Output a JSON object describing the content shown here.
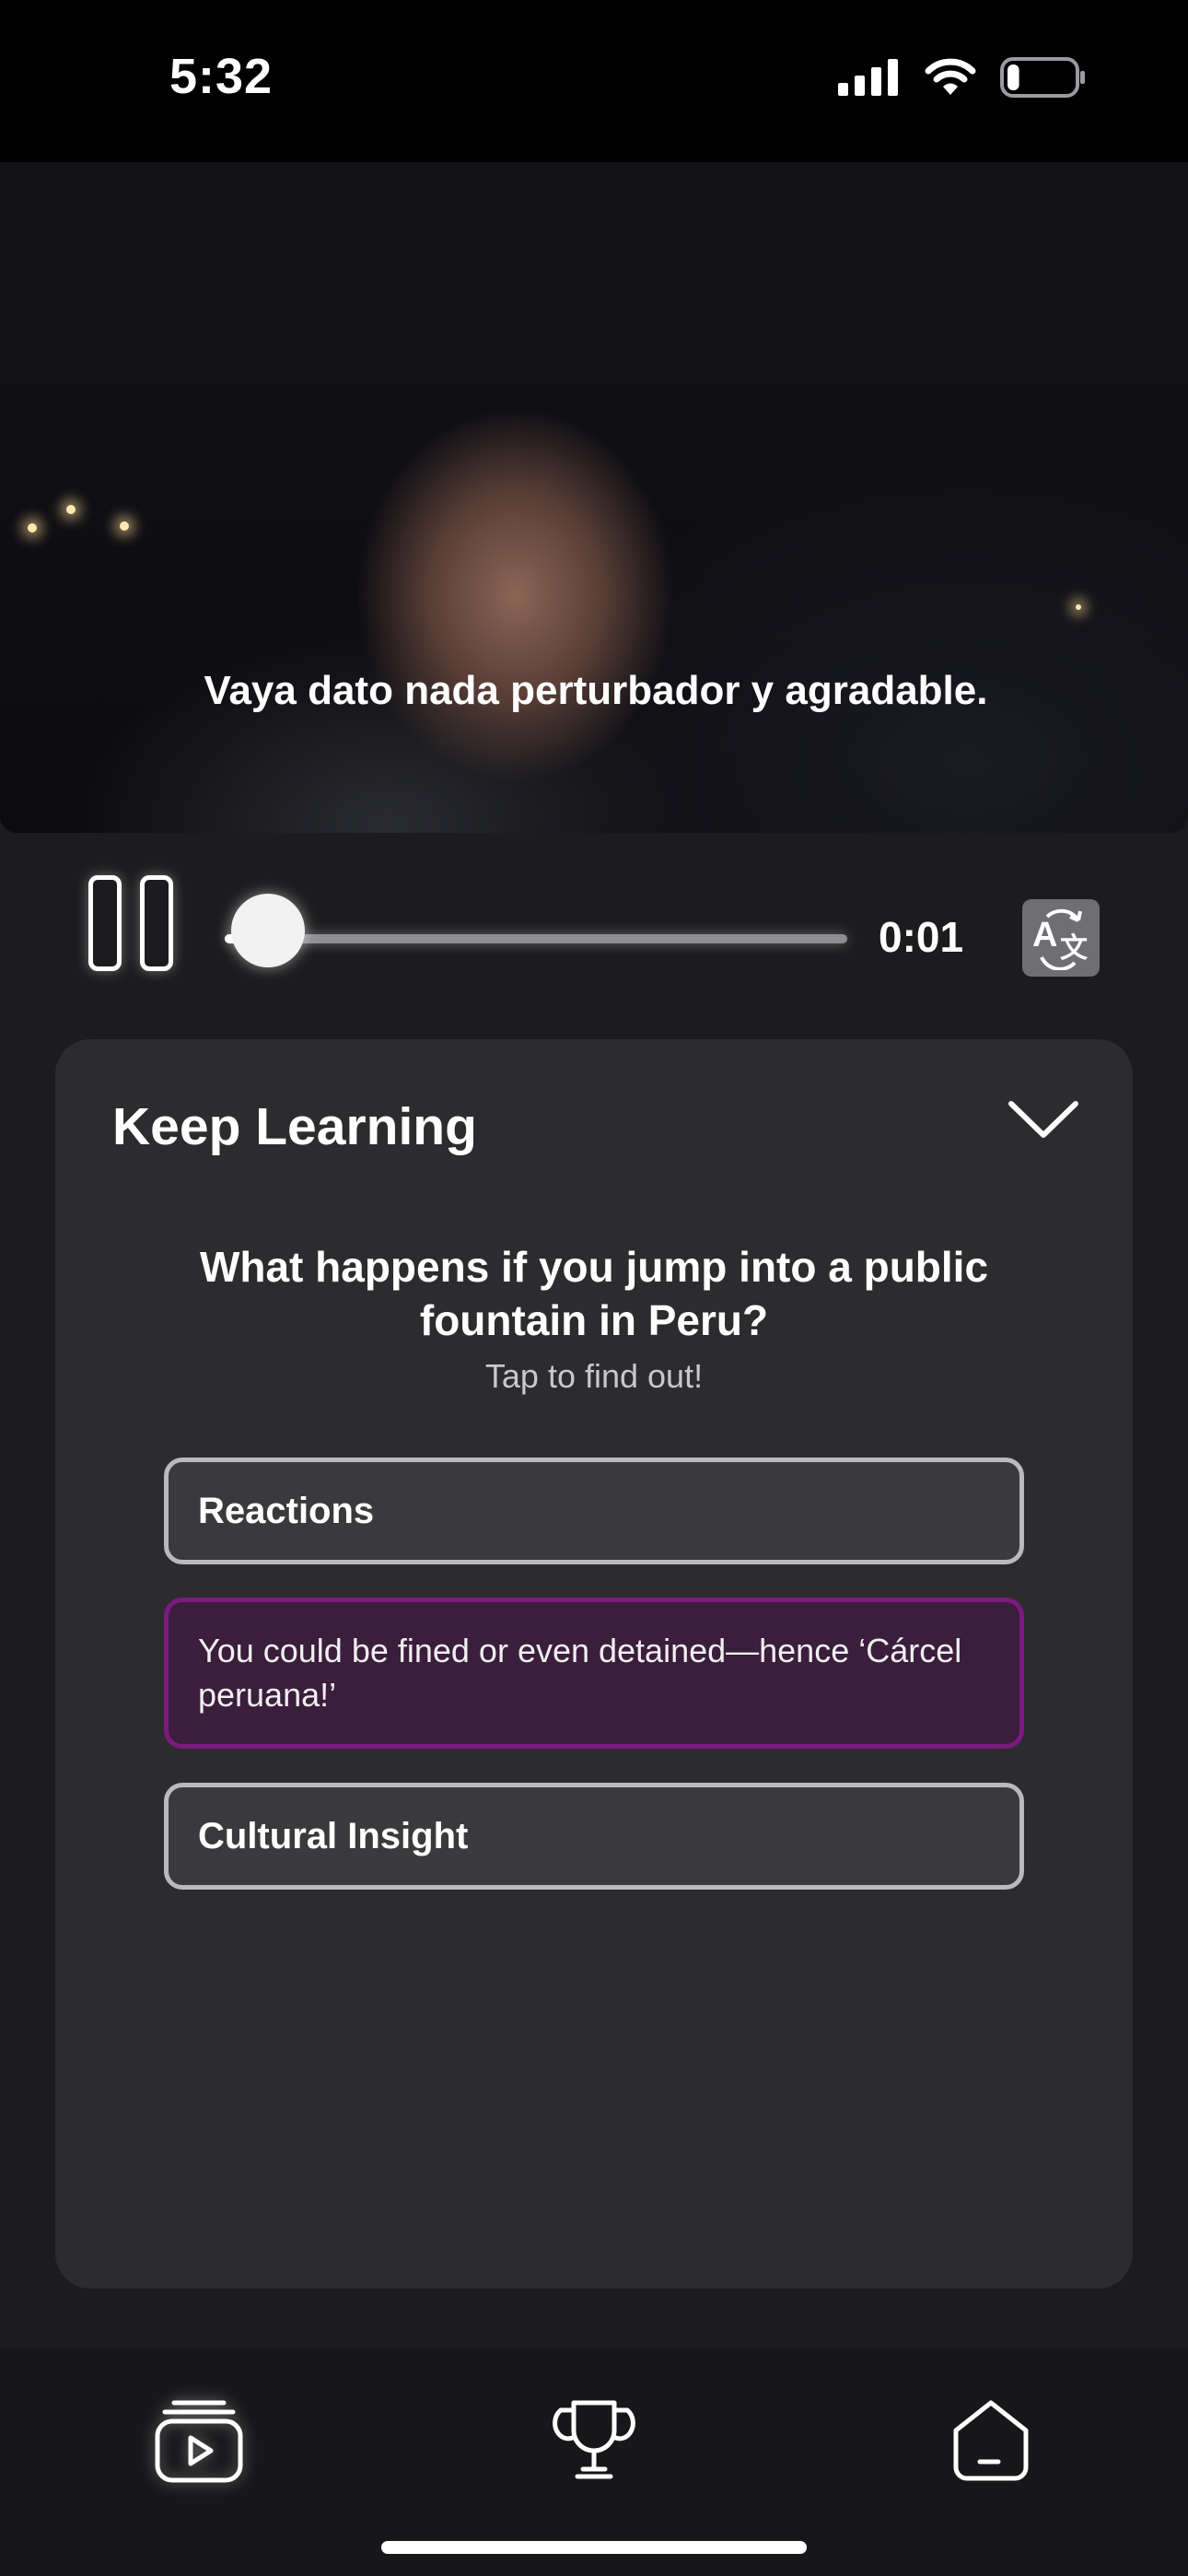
{
  "status_bar": {
    "time": "5:32",
    "icons": [
      "cellular-signal-icon",
      "wifi-icon",
      "battery-icon"
    ],
    "battery_level": 0.18
  },
  "video": {
    "subtitle": "Vaya dato nada perturbador y agradable."
  },
  "player": {
    "elapsed": "0:01",
    "progress": 0.07,
    "play_state": "playing",
    "translate_icon": "translate-icon"
  },
  "keep_learning": {
    "title": "Keep Learning",
    "question": "What happens if you jump into a public fountain in Peru?",
    "hint": "Tap to find out!",
    "options": [
      {
        "label": "Reactions",
        "expanded": false
      },
      {
        "label": "You could be fined or even detained—hence ‘Cárcel peruana!’",
        "expanded": true
      },
      {
        "label": "Cultural Insight",
        "expanded": false
      }
    ]
  },
  "tab_bar": {
    "tabs": [
      "videos-tab-icon",
      "trophy-icon",
      "profile-icon"
    ],
    "active": "videos-tab-icon"
  },
  "colors": {
    "accent_purple": "#7d1a80",
    "panel": "#2c2c2e",
    "background": "#1c1c1e"
  }
}
